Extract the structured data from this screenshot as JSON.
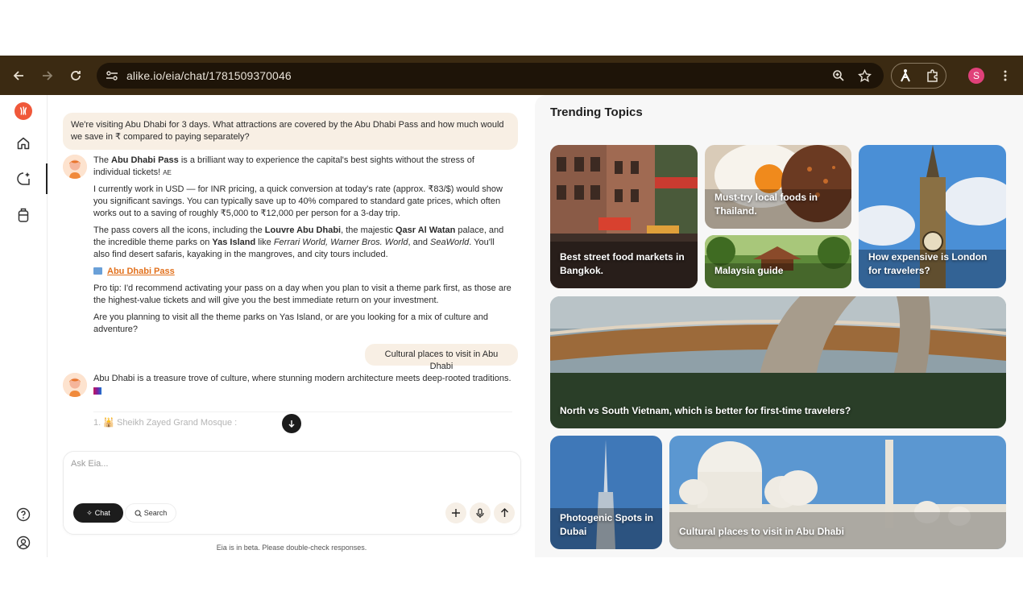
{
  "browser": {
    "url": "alike.io/eia/chat/1781509370046",
    "profile_initial": "S"
  },
  "rail": {
    "items": [
      "logo-icon",
      "home-icon",
      "chat-icon",
      "trips-icon",
      "help-icon",
      "profile-icon"
    ]
  },
  "chat": {
    "user_message_1": "We're visiting Abu Dhabi for 3 days. What attractions are covered by the Abu Dhabi Pass and how much would we save in ₹ compared to paying separately?",
    "bot_reply_1": {
      "p1_pre": "The ",
      "p1_bold": "Abu Dhabi Pass",
      "p1_post": " is a brilliant way to experience the capital's best sights without the stress of individual tickets! ",
      "p1_flag": "AE",
      "p2": "I currently work in USD — for INR pricing, a quick conversion at today's rate (approx. ₹83/$) would show you significant savings. You can typically save up to 40% compared to standard gate prices, which often works out to a saving of roughly ₹5,000 to ₹12,000 per person for a 3-day trip.",
      "p3_a": "The pass covers all the icons, including the ",
      "p3_b": "Louvre Abu Dhabi",
      "p3_c": ", the majestic ",
      "p3_d": "Qasr Al Watan",
      "p3_e": " palace, and the incredible theme parks on ",
      "p3_f": "Yas Island",
      "p3_g": " like ",
      "p3_h": "Ferrari World, Warner Bros. World",
      "p3_i": ", and ",
      "p3_j": "SeaWorld",
      "p3_k": ". You'll also find desert safaris, kayaking in the mangroves, and city tours included.",
      "link_label": "Abu Dhabi Pass",
      "p4": "Pro tip: I'd recommend activating your pass on a day when you plan to visit a theme park first, as those are the highest-value tickets and will give you the best immediate return on your investment.",
      "p5": "Are you planning to visit all the theme parks on Yas Island, or are you looking for a mix of culture and adventure?"
    },
    "user_message_2": "Cultural places to visit in Abu Dhabi",
    "bot_reply_2": {
      "p1": "Abu Dhabi is a treasure trove of culture, where stunning modern architecture meets deep-rooted traditions.",
      "item_1": "1. 🕌 Sheikh Zayed Grand Mosque :"
    },
    "composer": {
      "placeholder": "Ask Eia...",
      "chat_label": "Chat",
      "search_label": "Search"
    },
    "footer": "Eia is in beta. Please double-check responses."
  },
  "trending": {
    "title": "Trending Topics",
    "cards": [
      "Best street food markets in Bangkok.",
      "Must-try local foods in Thailand.",
      "Malaysia guide",
      "How expensive is London for travelers?",
      "North vs South Vietnam, which is better for first-time travelers?",
      "Photogenic Spots in Dubai",
      "Cultural places to visit in Abu Dhabi"
    ]
  },
  "colors": {
    "toolbar": "#3b2a12",
    "accent": "#e2711d",
    "bubble": "#f8efe4"
  }
}
